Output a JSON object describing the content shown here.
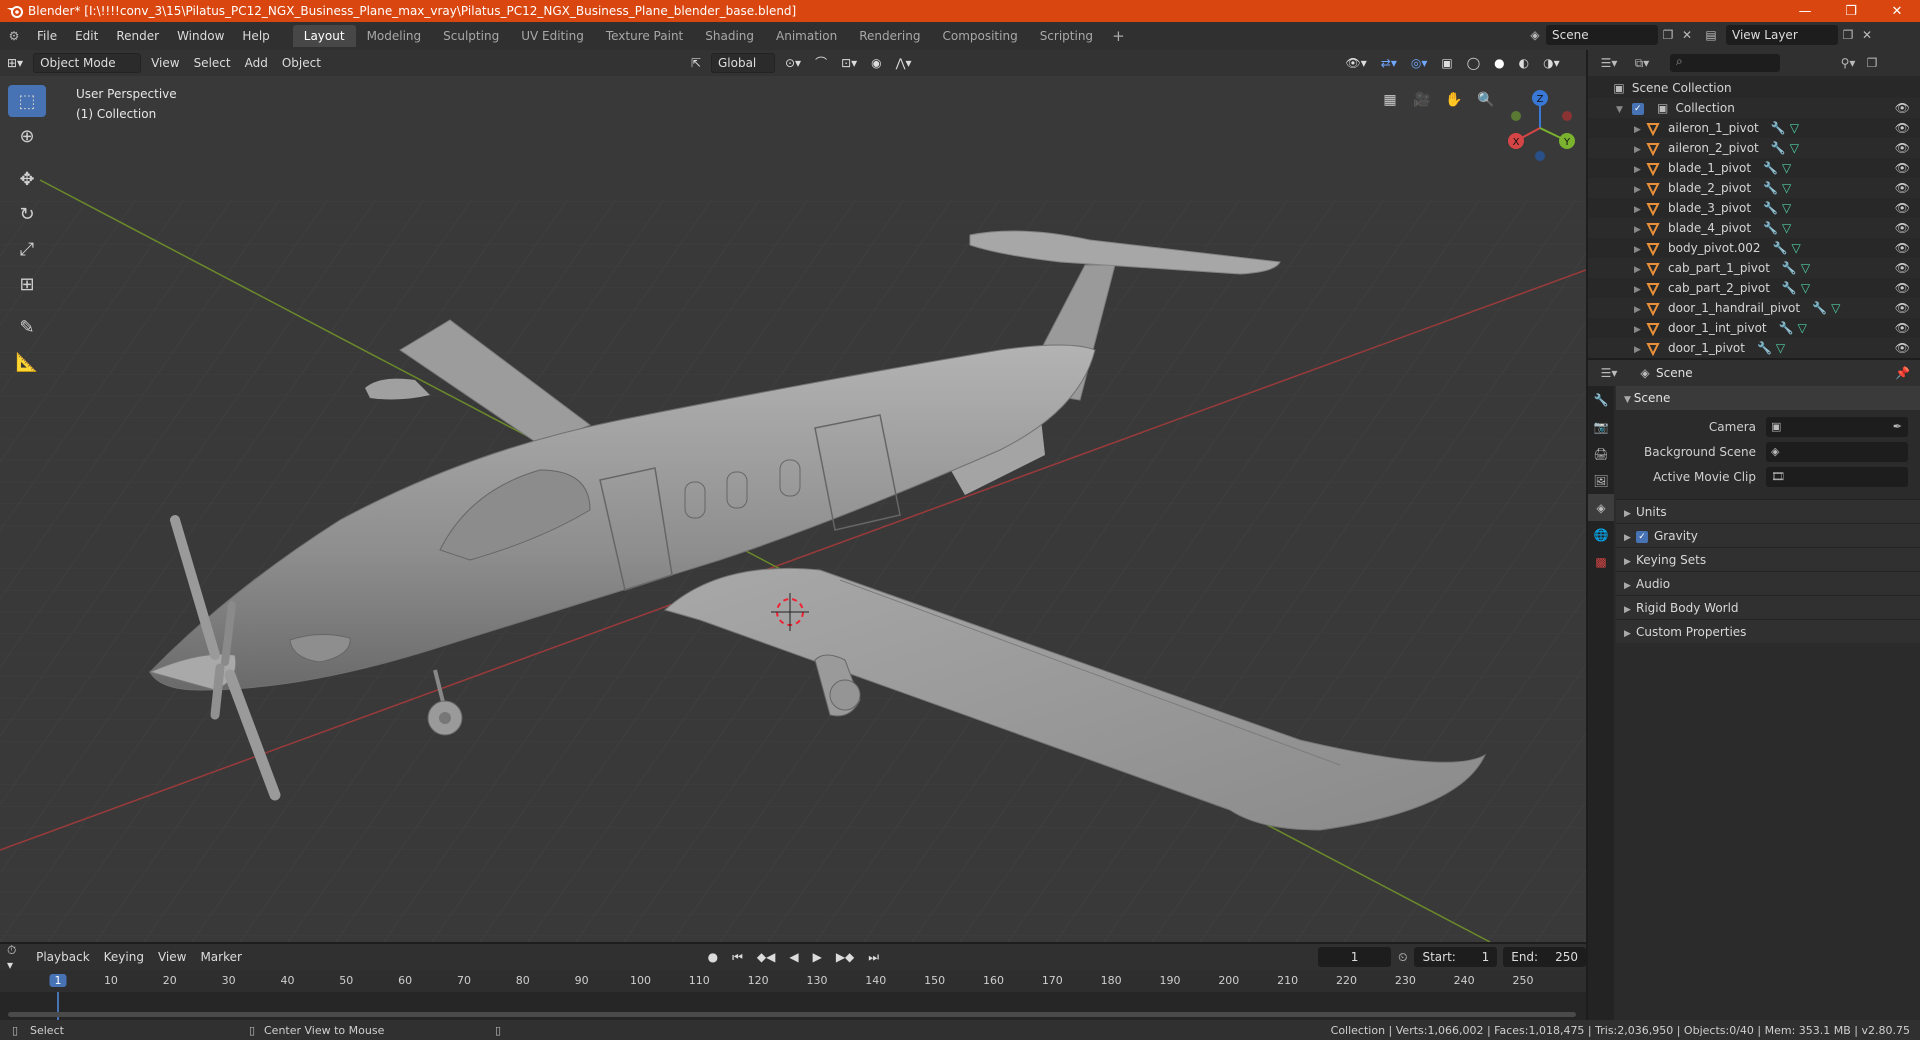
{
  "titlebar": {
    "title": "Blender* [I:\\!!!!conv_3\\15\\Pilatus_PC12_NGX_Business_Plane_max_vray\\Pilatus_PC12_NGX_Business_Plane_blender_base.blend]",
    "minimize": "—",
    "maximize": "❐",
    "close": "✕"
  },
  "menu": [
    "File",
    "Edit",
    "Render",
    "Window",
    "Help"
  ],
  "workspaces": [
    "Layout",
    "Modeling",
    "Sculpting",
    "UV Editing",
    "Texture Paint",
    "Shading",
    "Animation",
    "Rendering",
    "Compositing",
    "Scripting"
  ],
  "active_workspace": "Layout",
  "scene_name": "Scene",
  "view_layer": "View Layer",
  "viewport": {
    "mode": "Object Mode",
    "menus": [
      "View",
      "Select",
      "Add",
      "Object"
    ],
    "orientation": "Global",
    "overlay_line1": "User Perspective",
    "overlay_line2": "(1) Collection",
    "gizmo_axes": {
      "x": "X",
      "y": "Y",
      "z": "Z"
    }
  },
  "outliner": {
    "root": "Scene Collection",
    "collection": "Collection",
    "items": [
      "aileron_1_pivot",
      "aileron_2_pivot",
      "blade_1_pivot",
      "blade_2_pivot",
      "blade_3_pivot",
      "blade_4_pivot",
      "body_pivot.002",
      "cab_part_1_pivot",
      "cab_part_2_pivot",
      "door_1_handrail_pivot",
      "door_1_int_pivot",
      "door_1_pivot"
    ]
  },
  "properties": {
    "header": "Scene",
    "panel": "Scene",
    "rows": [
      {
        "label": "Camera"
      },
      {
        "label": "Background Scene"
      },
      {
        "label": "Active Movie Clip"
      }
    ],
    "subpanels": [
      "Units",
      "Gravity",
      "Keying Sets",
      "Audio",
      "Rigid Body World",
      "Custom Properties"
    ]
  },
  "timeline": {
    "menus": [
      "Playback",
      "Keying",
      "View",
      "Marker"
    ],
    "current_frame": "1",
    "start_label": "Start:",
    "start": "1",
    "end_label": "End:",
    "end": "250",
    "ruler": [
      "1",
      "10",
      "20",
      "30",
      "40",
      "50",
      "60",
      "70",
      "80",
      "90",
      "100",
      "110",
      "120",
      "130",
      "140",
      "150",
      "160",
      "170",
      "180",
      "190",
      "200",
      "210",
      "220",
      "230",
      "240",
      "250"
    ]
  },
  "status": {
    "left_action": "Select",
    "middle_action": "Center View to Mouse",
    "stats": "Collection | Verts:1,066,002 | Faces:1,018,475 | Tris:2,036,950 | Objects:0/40 | Mem: 353.1 MB | v2.80.75"
  },
  "colors": {
    "title_bar": "#d9460f",
    "accent_blue": "#4772b3",
    "object_orange": "#e8913a",
    "modifier_blue": "#71a8ff",
    "mesh_green": "#4fd1a5"
  }
}
